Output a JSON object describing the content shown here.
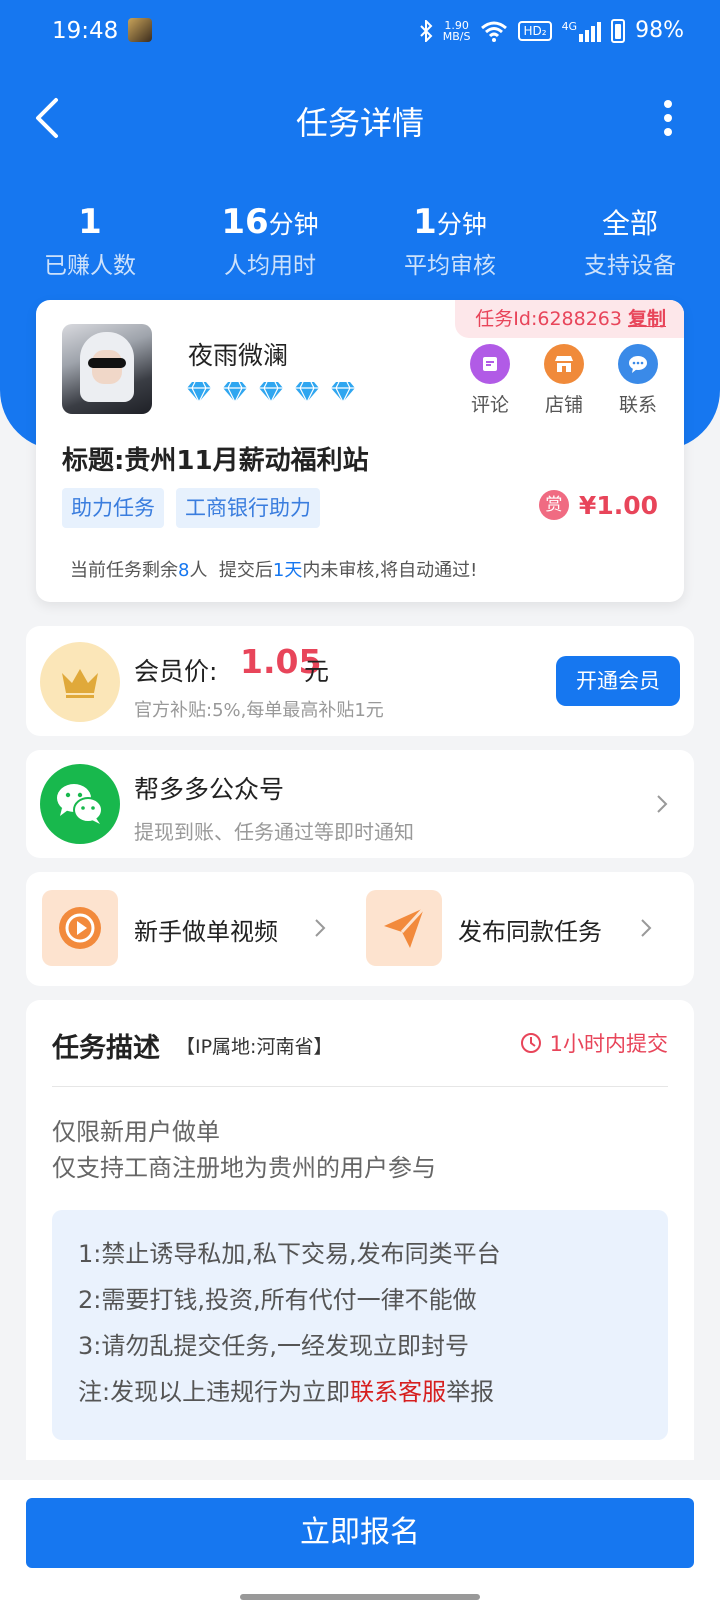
{
  "status_bar": {
    "time": "19:48",
    "net_speed_top": "1.90",
    "net_speed_bottom": "MB/S",
    "hd_label": "HD₂",
    "signal_label": "4G",
    "battery": "98%"
  },
  "nav": {
    "title": "任务详情"
  },
  "stats": [
    {
      "value": "1",
      "unit": "",
      "label": "已赚人数"
    },
    {
      "value": "16",
      "unit": "分钟",
      "label": "人均用时"
    },
    {
      "value": "1",
      "unit": "分钟",
      "label": "平均审核"
    },
    {
      "value": "全部",
      "unit": "",
      "label": "支持设备"
    }
  ],
  "task": {
    "id_text": "任务Id:6288263",
    "copy_label": "复制",
    "username": "夜雨微澜",
    "gem_count": 5,
    "actions": [
      {
        "label": "评论",
        "color": "#b15be6",
        "icon": "comment-icon"
      },
      {
        "label": "店铺",
        "color": "#f08a3a",
        "icon": "shop-icon"
      },
      {
        "label": "联系",
        "color": "#3a8ae8",
        "icon": "chat-icon"
      }
    ],
    "title": "标题:贵州11月薪动福利站",
    "tags": [
      "助力任务",
      "工商银行助力"
    ],
    "reward_badge": "赏",
    "reward": "¥1.00",
    "remain_prefix": "当前任务剩余",
    "remain_count": "8",
    "remain_mid": "人  提交后",
    "remain_days": "1天",
    "remain_suffix": "内未审核,将自动通过!"
  },
  "member": {
    "label": "会员价:",
    "price": "1.05",
    "unit": "元",
    "subtitle": "官方补贴:5%,每单最高补贴1元",
    "button": "开通会员"
  },
  "wechat": {
    "title": "帮多多公众号",
    "subtitle": "提现到账、任务通过等即时通知"
  },
  "shortcuts": {
    "video_label": "新手做单视频",
    "publish_label": "发布同款任务"
  },
  "description": {
    "title": "任务描述",
    "ip": "【IP属地:河南省】",
    "deadline": "1小时内提交",
    "lines": [
      "仅限新用户做单",
      "仅支持工商注册地为贵州的用户参与"
    ],
    "rules": [
      "1:禁止诱导私加,私下交易,发布同类平台",
      "2:需要打钱,投资,所有代付一律不能做",
      "3:请勿乱提交任务,一经发现立即封号"
    ],
    "note_prefix": "注:发现以上违规行为立即",
    "note_link": "联系客服",
    "note_suffix": "举报"
  },
  "cta": {
    "label": "立即报名"
  },
  "colors": {
    "primary": "#1677f0",
    "accent": "#e8455a",
    "wechat": "#18b84d"
  }
}
